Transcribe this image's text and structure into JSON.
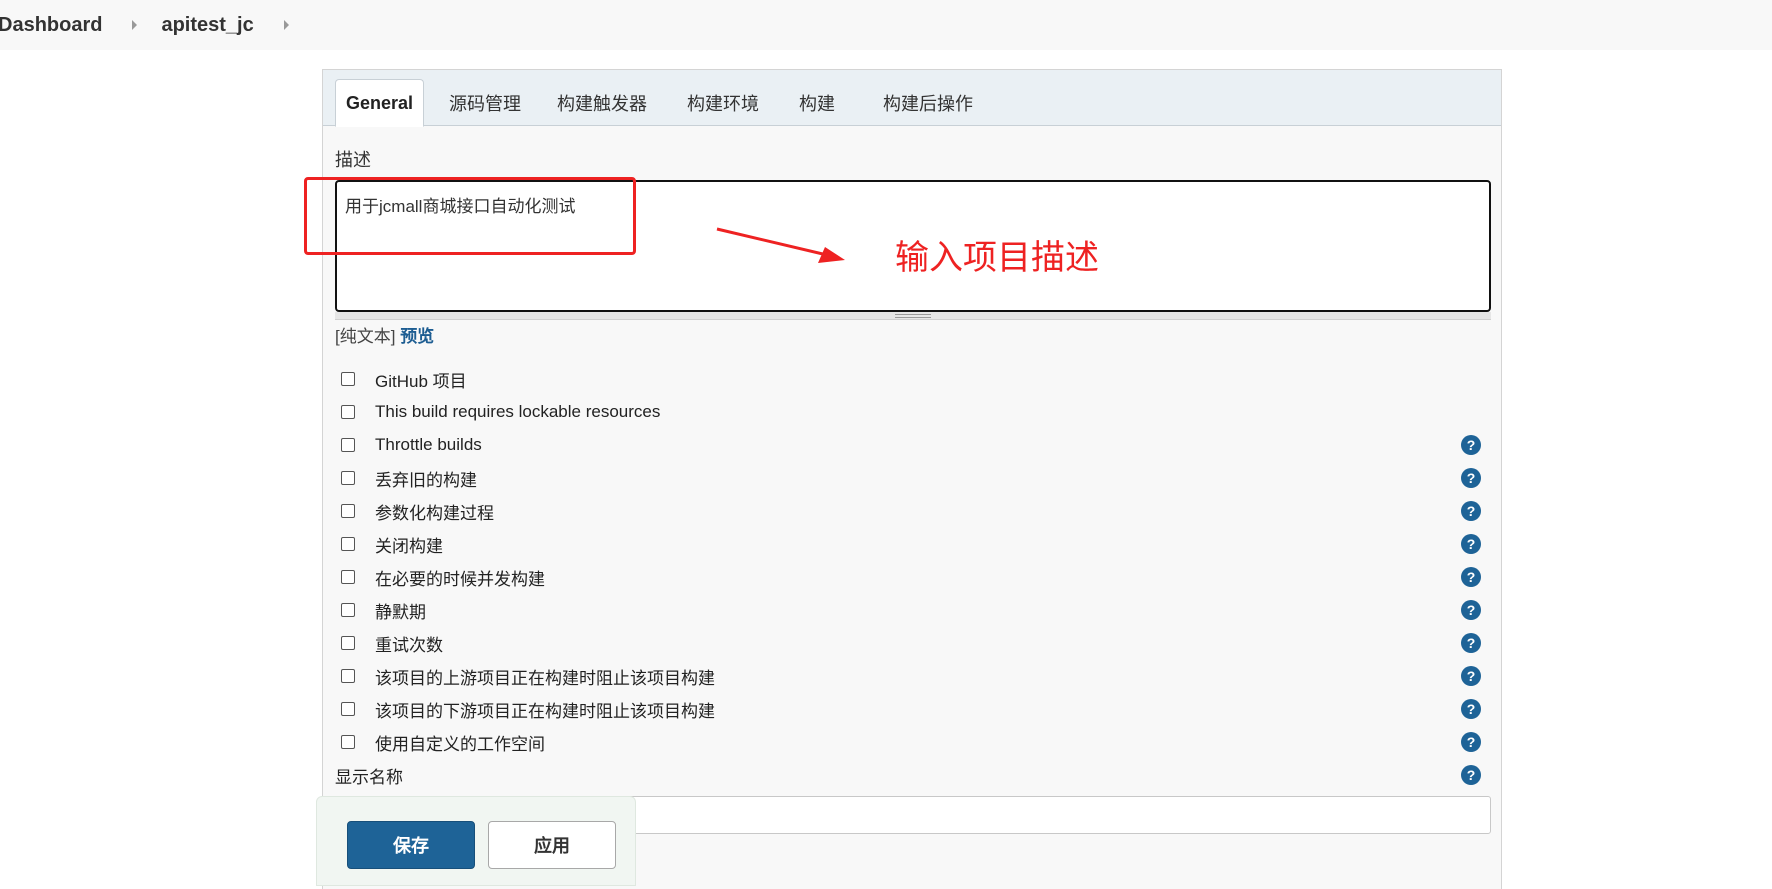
{
  "breadcrumb": {
    "dashboard": "Dashboard",
    "project": "apitest_jc"
  },
  "tabs": [
    {
      "label": "General"
    },
    {
      "label": "源码管理"
    },
    {
      "label": "构建触发器"
    },
    {
      "label": "构建环境"
    },
    {
      "label": "构建"
    },
    {
      "label": "构建后操作"
    }
  ],
  "description": {
    "label": "描述",
    "value": "用于jcmall商城接口自动化测试",
    "format_plain": "[纯文本]",
    "format_preview": "预览"
  },
  "options": [
    {
      "label": "GitHub 项目",
      "help": false
    },
    {
      "label": "This build requires lockable resources",
      "help": false
    },
    {
      "label": "Throttle builds",
      "help": true
    },
    {
      "label": "丢弃旧的构建",
      "help": true
    },
    {
      "label": "参数化构建过程",
      "help": true
    },
    {
      "label": "关闭构建",
      "help": true
    },
    {
      "label": "在必要的时候并发构建",
      "help": true
    },
    {
      "label": "静默期",
      "help": true
    },
    {
      "label": "重试次数",
      "help": true
    },
    {
      "label": "该项目的上游项目正在构建时阻止该项目构建",
      "help": true
    },
    {
      "label": "该项目的下游项目正在构建时阻止该项目构建",
      "help": true
    },
    {
      "label": "使用自定义的工作空间",
      "help": true
    }
  ],
  "display_name": {
    "label": "显示名称",
    "value": ""
  },
  "help_glyph": "?",
  "buttons": {
    "save": "保存",
    "apply": "应用"
  },
  "annotation": {
    "text": "输入项目描述",
    "color": "#ee2222"
  },
  "colors": {
    "primary": "#1e6397",
    "annotation_red": "#ee2222"
  }
}
